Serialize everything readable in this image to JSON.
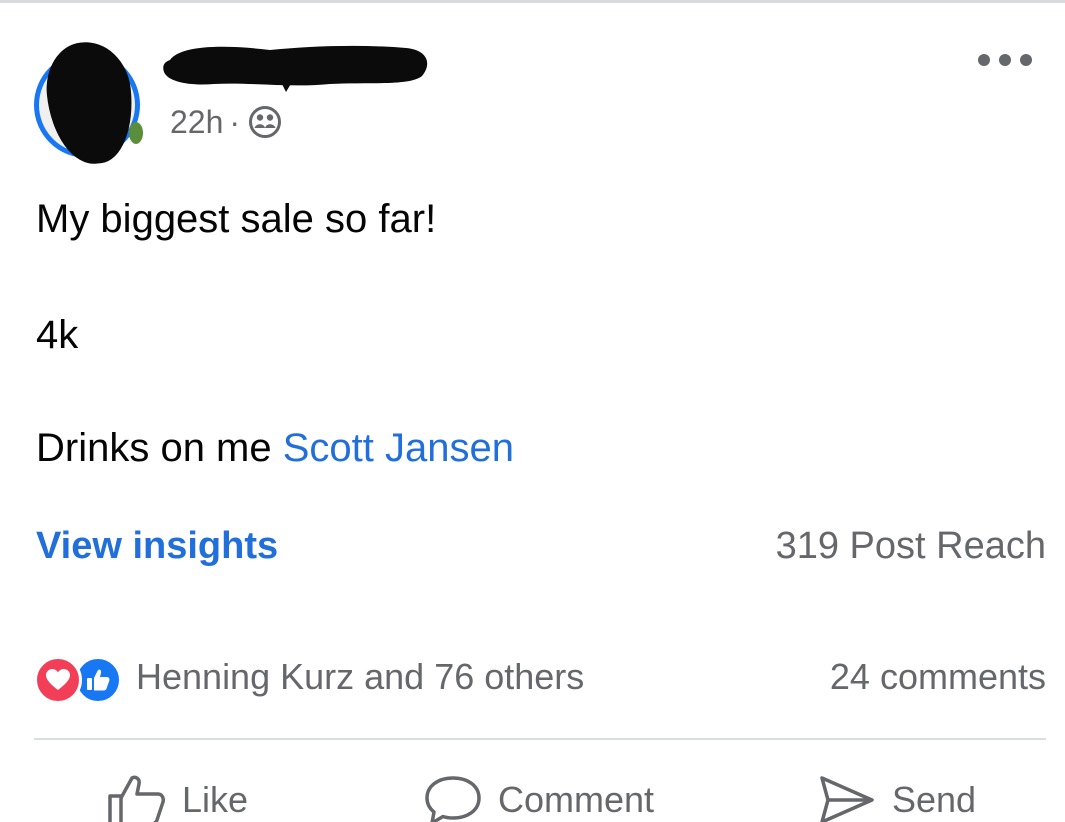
{
  "post": {
    "time": "22h",
    "separator": "·",
    "audience_icon": "friends-icon",
    "text_line1": "My biggest sale so far!",
    "text_line2": "4k",
    "text_line3_prefix": "Drinks on me ",
    "mention": "Scott Jansen"
  },
  "insights": {
    "link_label": "View insights",
    "reach": "319 Post Reach"
  },
  "reactions": {
    "icons": [
      "love-icon",
      "like-icon"
    ],
    "summary": "Henning Kurz and 76 others",
    "comments": "24 comments"
  },
  "actions": {
    "like": "Like",
    "comment": "Comment",
    "send": "Send"
  },
  "colors": {
    "accent_blue": "#216fdb",
    "avatar_ring": "#1877f2",
    "secondary_text": "#65676b",
    "love_red": "#f33e58",
    "like_blue": "#1877f2"
  }
}
